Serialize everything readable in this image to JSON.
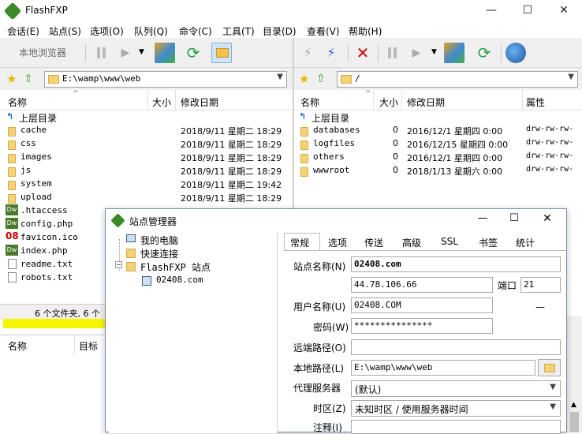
{
  "app": {
    "title": "FlashFXP"
  },
  "menu": [
    "会话(E)",
    "站点(S)",
    "选项(O)",
    "队列(Q)",
    "命令(C)",
    "工具(T)",
    "目录(D)",
    "查看(V)",
    "帮助(H)"
  ],
  "left_toolbar": {
    "local_browser": "本地浏览器"
  },
  "left": {
    "path": "E:\\wamp\\www\\web",
    "columns": {
      "name": "名称",
      "size": "大小",
      "modified": "修改日期"
    },
    "parent": "上层目录",
    "files": [
      {
        "name": "cache",
        "size": "",
        "date": "2018/9/11 星期二 18:29",
        "type": "folder"
      },
      {
        "name": "css",
        "size": "",
        "date": "2018/9/11 星期二 18:29",
        "type": "folder"
      },
      {
        "name": "images",
        "size": "",
        "date": "2018/9/11 星期二 18:29",
        "type": "folder"
      },
      {
        "name": "js",
        "size": "",
        "date": "2018/9/11 星期二 18:29",
        "type": "folder"
      },
      {
        "name": "system",
        "size": "",
        "date": "2018/9/11 星期二 19:42",
        "type": "folder"
      },
      {
        "name": "upload",
        "size": "",
        "date": "2018/9/11 星期二 18:29",
        "type": "folder"
      },
      {
        "name": ".htaccess",
        "size": "",
        "date": "",
        "type": "dw"
      },
      {
        "name": "config.php",
        "size": "",
        "date": "",
        "type": "dw"
      },
      {
        "name": "favicon.ico",
        "size": "",
        "date": "",
        "type": "ico"
      },
      {
        "name": "index.php",
        "size": "",
        "date": "",
        "type": "dw"
      },
      {
        "name": "readme.txt",
        "size": "",
        "date": "",
        "type": "txt"
      },
      {
        "name": "robots.txt",
        "size": "",
        "date": "",
        "type": "txt"
      }
    ],
    "status": "6 个文件夹, 6 个",
    "queue_columns": {
      "name": "名称",
      "target": "目标"
    }
  },
  "right": {
    "path": "/",
    "columns": {
      "name": "名称",
      "size": "大小",
      "modified": "修改日期",
      "attr": "属性"
    },
    "parent": "上层目录",
    "files": [
      {
        "name": "databases",
        "size": "0",
        "date": "2016/12/1 星期四 0:00",
        "attr": "drw-rw-rw-"
      },
      {
        "name": "logfiles",
        "size": "0",
        "date": "2016/12/15 星期四 0:00",
        "attr": "drw-rw-rw-"
      },
      {
        "name": "others",
        "size": "0",
        "date": "2016/12/1 星期四 0:00",
        "attr": "drw-rw-rw-"
      },
      {
        "name": "wwwroot",
        "size": "0",
        "date": "2018/1/13 星期六 0:00",
        "attr": "drw-rw-rw-"
      }
    ]
  },
  "dialog": {
    "title": "站点管理器",
    "tree": {
      "my_computer": "我的电脑",
      "quick_connect": "快速连接",
      "sites": "FlashFXP 站点",
      "site": "02408.com"
    },
    "tabs": [
      "常规",
      "选项",
      "传送",
      "高级",
      "SSL",
      "书签",
      "统计"
    ],
    "labels": {
      "site_name": "站点名称(N)",
      "port": "端口",
      "username": "用户名称(U)",
      "password": "密码(W)",
      "remote_path": "远端路径(O)",
      "local_path": "本地路径(L)",
      "proxy": "代理服务器",
      "timezone": "时区(Z)",
      "notes": "注释(I)"
    },
    "values": {
      "site_name": "02408.com",
      "host": "44.78.106.66",
      "port": "21",
      "username": "02408.COM",
      "password": "***************",
      "remote_path": "",
      "local_path": "E:\\wamp\\www\\web",
      "proxy": "(默认)",
      "timezone": "未知时区 / 使用服务器时间",
      "notes": ""
    }
  }
}
